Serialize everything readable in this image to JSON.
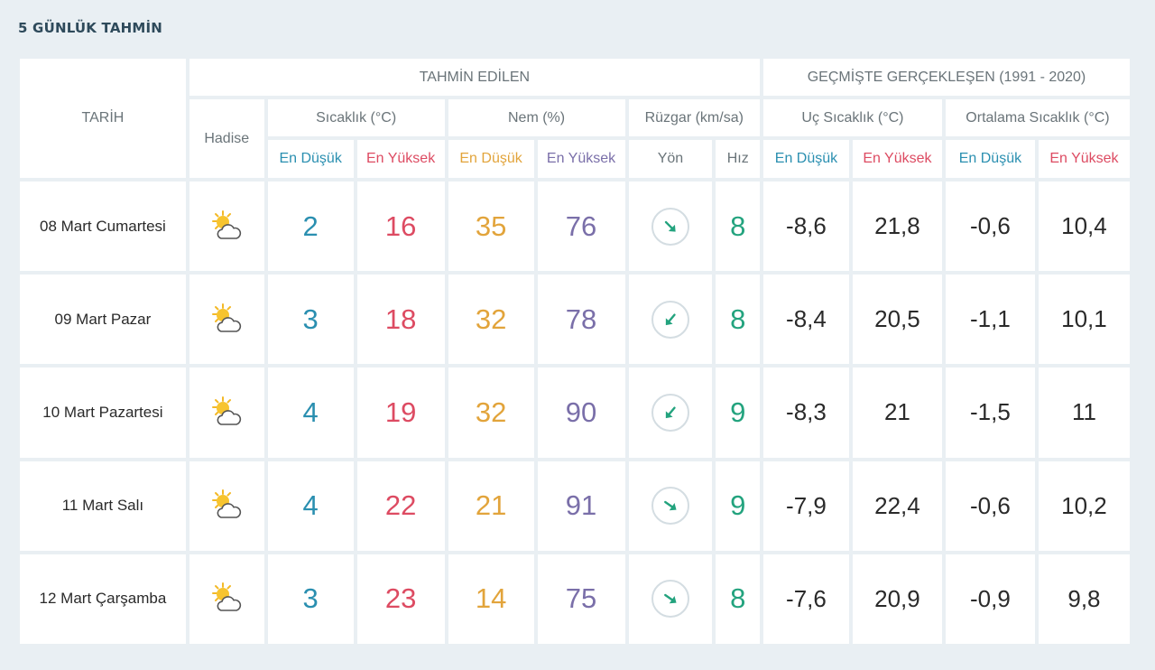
{
  "page_title": "5 GÜNLÜK TAHMİN",
  "headers": {
    "date": "TARİH",
    "forecast_group": "TAHMİN EDİLEN",
    "history_group": "GEÇMİŞTE GERÇEKLEŞEN (1991 - 2020)",
    "event": "Hadise",
    "temperature": "Sıcaklık (°C)",
    "humidity": "Nem (%)",
    "wind": "Rüzgar (km/sa)",
    "extreme_temp": "Uç Sıcaklık (°C)",
    "average_temp": "Ortalama Sıcaklık (°C)",
    "temp_min": "En Düşük",
    "temp_max": "En Yüksek",
    "hum_min": "En Düşük",
    "hum_max": "En Yüksek",
    "wind_dir": "Yön",
    "wind_speed": "Hız",
    "ext_min": "En Düşük",
    "ext_max": "En Yüksek",
    "avg_min": "En Düşük",
    "avg_max": "En Yüksek"
  },
  "colors": {
    "blue": "#2a8fb0",
    "red": "#dd4b62",
    "orange": "#e2a43b",
    "purple": "#7a6fa9",
    "green": "#23a37e"
  },
  "rows": [
    {
      "date": "08 Mart Cumartesi",
      "icon": "partly-cloudy-icon",
      "temp_min": "2",
      "temp_max": "16",
      "hum_min": "35",
      "hum_max": "76",
      "wind_dir_deg": 135,
      "wind_speed": "8",
      "ext_min": "-8,6",
      "ext_max": "21,8",
      "avg_min": "-0,6",
      "avg_max": "10,4"
    },
    {
      "date": "09 Mart Pazar",
      "icon": "partly-cloudy-icon",
      "temp_min": "3",
      "temp_max": "18",
      "hum_min": "32",
      "hum_max": "78",
      "wind_dir_deg": 220,
      "wind_speed": "8",
      "ext_min": "-8,4",
      "ext_max": "20,5",
      "avg_min": "-1,1",
      "avg_max": "10,1"
    },
    {
      "date": "10 Mart Pazartesi",
      "icon": "partly-cloudy-icon",
      "temp_min": "4",
      "temp_max": "19",
      "hum_min": "32",
      "hum_max": "90",
      "wind_dir_deg": 220,
      "wind_speed": "9",
      "ext_min": "-8,3",
      "ext_max": "21",
      "avg_min": "-1,5",
      "avg_max": "11"
    },
    {
      "date": "11 Mart Salı",
      "icon": "partly-cloudy-icon",
      "temp_min": "4",
      "temp_max": "22",
      "hum_min": "21",
      "hum_max": "91",
      "wind_dir_deg": 125,
      "wind_speed": "9",
      "ext_min": "-7,9",
      "ext_max": "22,4",
      "avg_min": "-0,6",
      "avg_max": "10,2"
    },
    {
      "date": "12 Mart Çarşamba",
      "icon": "partly-cloudy-icon",
      "temp_min": "3",
      "temp_max": "23",
      "hum_min": "14",
      "hum_max": "75",
      "wind_dir_deg": 125,
      "wind_speed": "8",
      "ext_min": "-7,6",
      "ext_max": "20,9",
      "avg_min": "-0,9",
      "avg_max": "9,8"
    }
  ]
}
